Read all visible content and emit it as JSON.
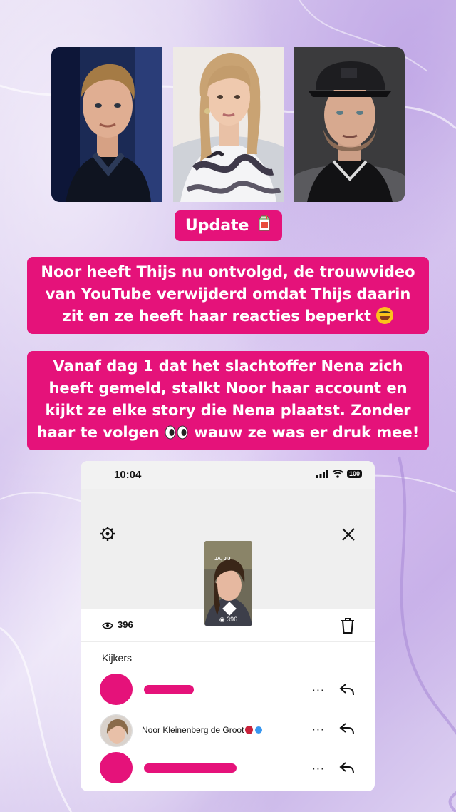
{
  "update_tag": {
    "label": "Update",
    "icon": "juice-box-icon"
  },
  "paragraph1": {
    "text": "Noor heeft Thijs nu ontvolgd, de trouwvideo van YouTube verwijderd omdat Thijs daarin zit en ze heeft haar reacties beperkt",
    "emoji": "face-with-tears-of-joy"
  },
  "paragraph2": {
    "text": "Vanaf dag 1 dat het slachtoffer Nena zich heeft gemeld, stalkt Noor haar account en kijkt ze elke story die Nena plaatst. Zonder haar te volgen",
    "emoji": "eyes",
    "text_after": "wauw ze was er druk mee!"
  },
  "colors": {
    "accent": "#e5127a",
    "background": "#ddd0f2"
  },
  "instagram": {
    "status_time": "10:04",
    "battery": "100",
    "thumbnail_caption": "JA, JIJ",
    "thumbnail_views": "396",
    "views_count": "396",
    "viewers_heading": "Kijkers",
    "viewers": [
      {
        "name": "",
        "redacted": true
      },
      {
        "name": "Noor Kleinenberg de Groot",
        "redacted": false,
        "verified": true
      },
      {
        "name": "",
        "redacted": true
      }
    ],
    "more_label": "···"
  }
}
